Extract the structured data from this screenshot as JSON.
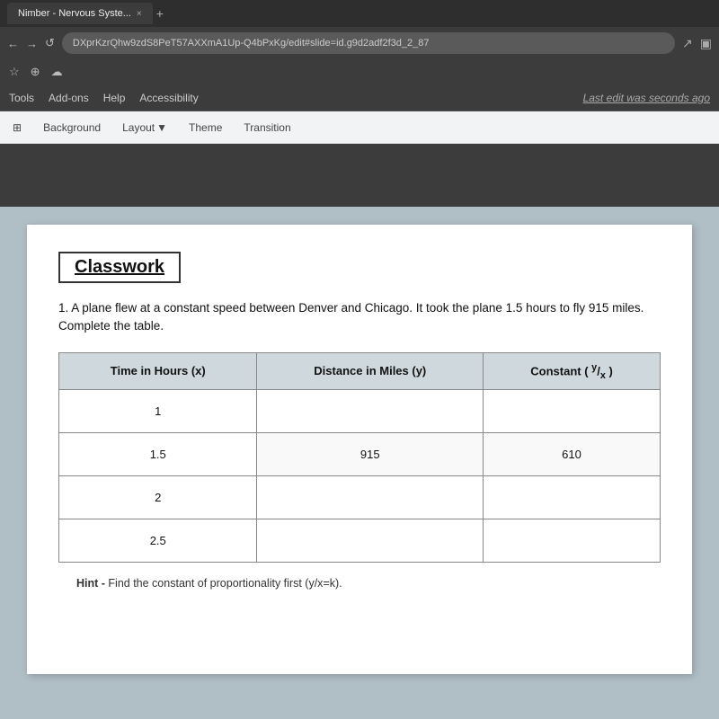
{
  "browser": {
    "tab_label": "Nimber - Nervous Syste...",
    "tab_close": "×",
    "url": "DXprKzrQhw9zdS8PeT57AXXmA1Up-Q4bPxKg/edit#slide=id.g9d2adf2f3d_2_87",
    "icons": {
      "star": "☆",
      "tab_new": "⊕",
      "cloud": "☁",
      "trend": "↗",
      "square": "▣"
    }
  },
  "menubar": {
    "items": [
      "Tools",
      "Add-ons",
      "Help",
      "Accessibility"
    ],
    "last_edit": "Last edit was seconds ago"
  },
  "slides_toolbar": {
    "background_label": "Background",
    "layout_label": "Layout",
    "layout_arrow": "▼",
    "theme_label": "Theme",
    "transition_label": "Transition",
    "insert_icon": "⊞"
  },
  "slide": {
    "title": "Classwork",
    "problem": "1.  A plane flew at a constant speed between Denver and Chicago. It took the plane 1.5 hours to fly 915 miles.  Complete the table.",
    "table": {
      "headers": [
        "Time in Hours (x)",
        "Distance in Miles (y)",
        "Constant ( y/x )"
      ],
      "rows": [
        {
          "time": "1",
          "distance": "",
          "constant": ""
        },
        {
          "time": "1.5",
          "distance": "915",
          "constant": "610"
        },
        {
          "time": "2",
          "distance": "",
          "constant": ""
        },
        {
          "time": "2.5",
          "distance": "",
          "constant": ""
        }
      ]
    },
    "hint": "Hint - Find the constant of proportionality first (y/x=k)."
  }
}
